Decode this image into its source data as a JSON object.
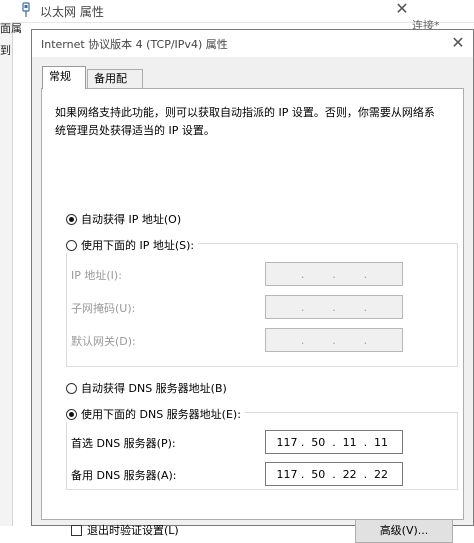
{
  "background_window": {
    "title": "以太网 属性",
    "frag_left_top": "面属",
    "frag_left_mid": "到",
    "frag_right": "连接*",
    "close_glyph": "✕"
  },
  "dialog": {
    "title": "Internet 协议版本 4 (TCP/IPv4) 属性",
    "close_glyph": "✕",
    "tabs": [
      "常规",
      "备用配置"
    ],
    "description": "如果网络支持此功能，则可以获取自动指派的 IP 设置。否则，你需要从网络系统管理员处获得适当的 IP 设置。",
    "ip_section": {
      "auto_label": "自动获得 IP 地址(O)",
      "manual_label": "使用下面的 IP 地址(S):",
      "auto_selected": true,
      "fields": [
        {
          "label": "IP 地址(I):",
          "octets": [
            "",
            "",
            "",
            ""
          ]
        },
        {
          "label": "子网掩码(U):",
          "octets": [
            "",
            "",
            "",
            ""
          ]
        },
        {
          "label": "默认网关(D):",
          "octets": [
            "",
            "",
            "",
            ""
          ]
        }
      ]
    },
    "dns_section": {
      "auto_label": "自动获得 DNS 服务器地址(B)",
      "manual_label": "使用下面的 DNS 服务器地址(E):",
      "manual_selected": true,
      "preferred": {
        "label": "首选 DNS 服务器(P):",
        "octets": [
          "117",
          "50",
          "11",
          "11"
        ]
      },
      "alternate": {
        "label": "备用 DNS 服务器(A):",
        "octets": [
          "117",
          "50",
          "22",
          "22"
        ]
      }
    },
    "validate_label": "退出时验证设置(L)",
    "advanced_button": "高级(V)..."
  }
}
